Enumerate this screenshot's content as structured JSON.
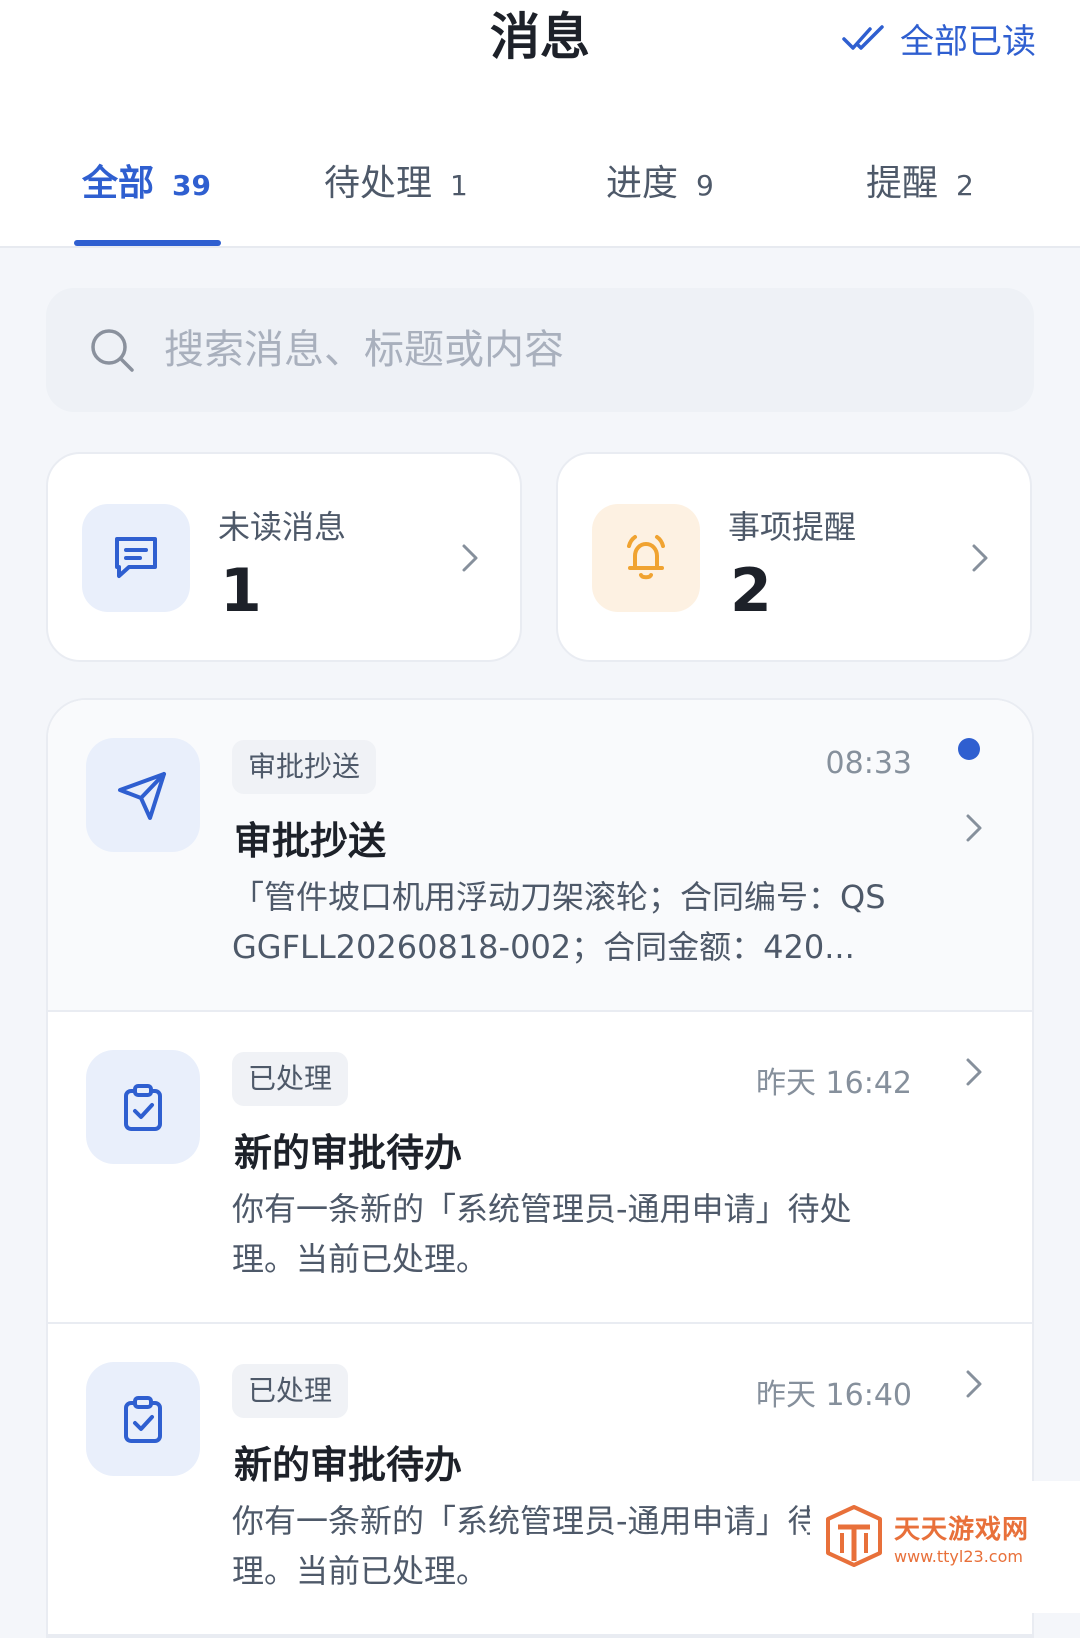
{
  "header": {
    "title": "消息",
    "mark_all_read": "全部已读"
  },
  "tabs": [
    {
      "label": "全部",
      "count": "39",
      "active": true
    },
    {
      "label": "待处理",
      "count": "1"
    },
    {
      "label": "进度",
      "count": "9"
    },
    {
      "label": "提醒",
      "count": "2"
    }
  ],
  "search": {
    "placeholder": "搜索消息、标题或内容",
    "value": ""
  },
  "summary": {
    "unread": {
      "label": "未读消息",
      "value": "1",
      "icon": "message-icon"
    },
    "reminders": {
      "label": "事项提醒",
      "value": "2",
      "icon": "bell-icon"
    }
  },
  "messages": [
    {
      "tag": "审批抄送",
      "time": "08:33",
      "unread": true,
      "title": "审批抄送",
      "body": "「管件坡口机用浮动刀架滚轮；合同编号：QSGGFLL20260818-002；合同金额：420...",
      "icon": "send-icon"
    },
    {
      "tag": "已处理",
      "time": "昨天 16:42",
      "unread": false,
      "title": "新的审批待办",
      "body": "你有一条新的「系统管理员-通用申请」待处理。当前已处理。",
      "icon": "clipboard-check-icon"
    },
    {
      "tag": "已处理",
      "time": "昨天 16:40",
      "unread": false,
      "title": "新的审批待办",
      "body": "你有一条新的「系统管理员-通用申请」待处理。当前已处理。",
      "icon": "clipboard-check-icon"
    }
  ],
  "watermark": {
    "name": "天天游戏网",
    "url": "www.ttyl23.com"
  },
  "colors": {
    "accent": "#2f5fd0",
    "bell": "#f0a331",
    "watermark": "#e8703a"
  }
}
